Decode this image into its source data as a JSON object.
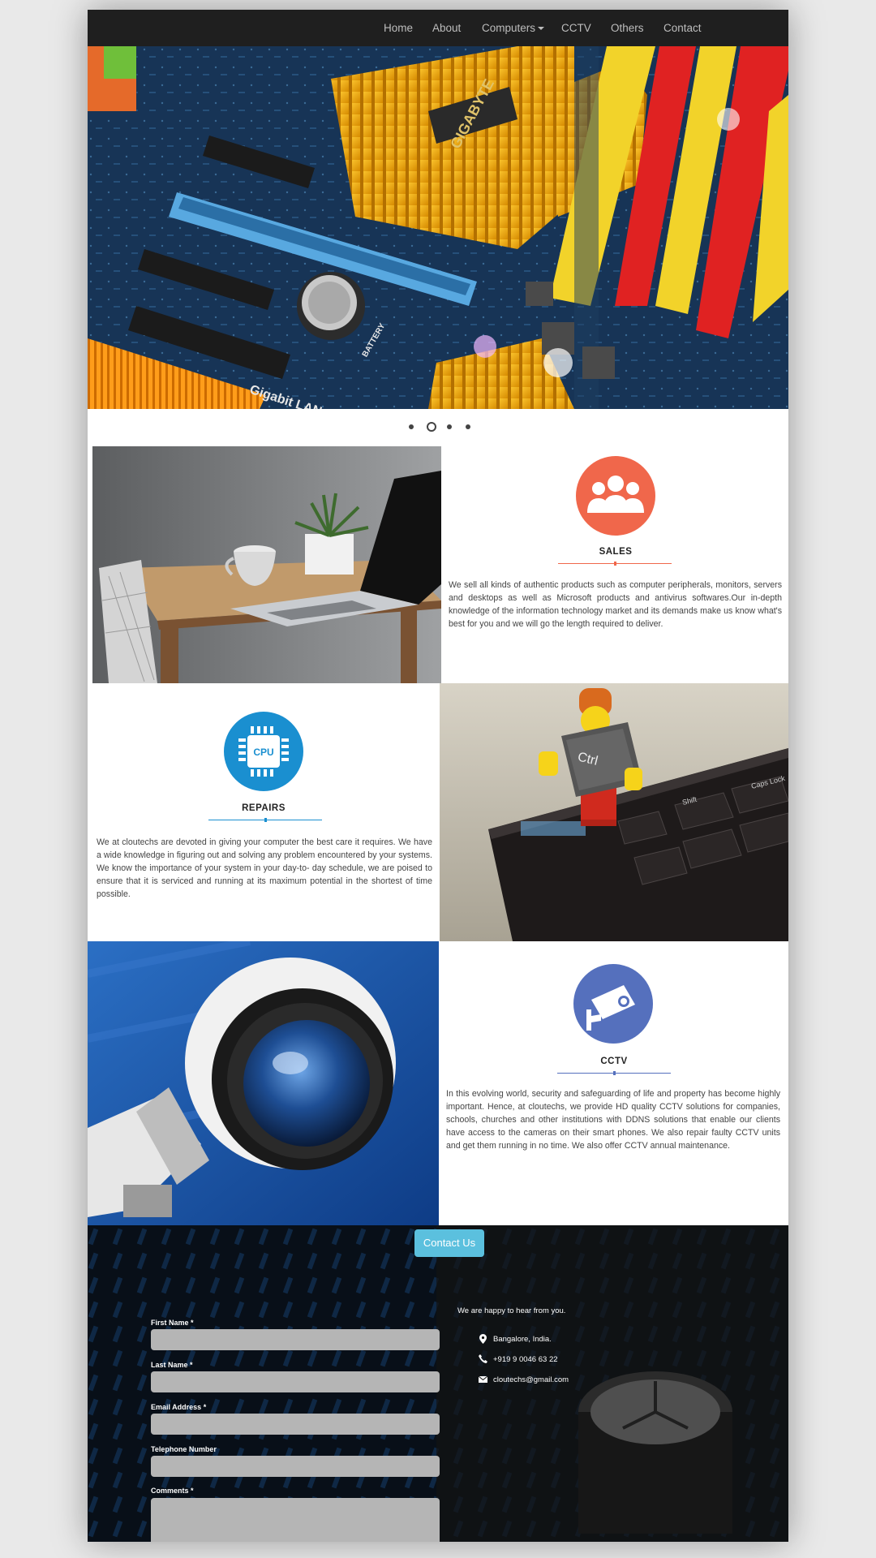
{
  "nav": {
    "items": [
      "Home",
      "About",
      "Computers",
      "CCTV",
      "Others",
      "Contact"
    ]
  },
  "hero": {
    "brand_text": "GIGABYTE",
    "board_texts": [
      "BATTERY",
      "Gigabit LAN",
      "Ctrl"
    ]
  },
  "carousel": {
    "dot_count": 4,
    "active_index": 1
  },
  "sales": {
    "title": "SALES",
    "text": "We sell all kinds of authentic products such as computer peripherals, monitors, servers and desktops as well as Microsoft products and antivirus softwares.Our in-depth knowledge of the information technology market and its demands make us know what's best for you and we will go the length required to deliver.",
    "color": "#f0674b"
  },
  "repairs": {
    "title": "REPAIRS",
    "icon_label": "CPU",
    "text": "We at cloutechs are devoted in giving your computer the best care it requires. We have a wide knowledge in figuring out and solving any problem encountered by your systems. We know the importance of your system in your day-to- day schedule, we are poised to ensure that it is serviced and running at its maximum potential in the shortest of time possible.",
    "color": "#1a8fd0"
  },
  "cctv": {
    "title": "CCTV",
    "text": "In this evolving world, security and safeguarding of life and property has become highly important. Hence, at cloutechs, we provide HD quality CCTV solutions for companies, schools, churches and other institutions with DDNS solutions that enable our clients have access to the cameras on their smart phones. We also repair faulty CCTV units and get them running in no time. We also offer CCTV annual maintenance.",
    "color": "#5570bd"
  },
  "photos": {
    "keyboard_key": "Ctrl",
    "keyboard_keys": [
      "Caps Lock",
      "Shift"
    ]
  },
  "contact": {
    "button_label": "Contact Us",
    "form": {
      "first_name": "First Name *",
      "last_name": "Last Name *",
      "email": "Email Address *",
      "telephone": "Telephone Number",
      "comments": "Comments *"
    },
    "tagline": "We are happy to hear from you.",
    "location": "Bangalore, India.",
    "phone": "+919 9 0046 63 22",
    "email": "cloutechs@gmail.com"
  },
  "colors": {
    "accent_sales": "#f0674b",
    "accent_repairs": "#1a8fd0",
    "accent_cctv": "#5570bd",
    "button": "#5bc0de"
  }
}
